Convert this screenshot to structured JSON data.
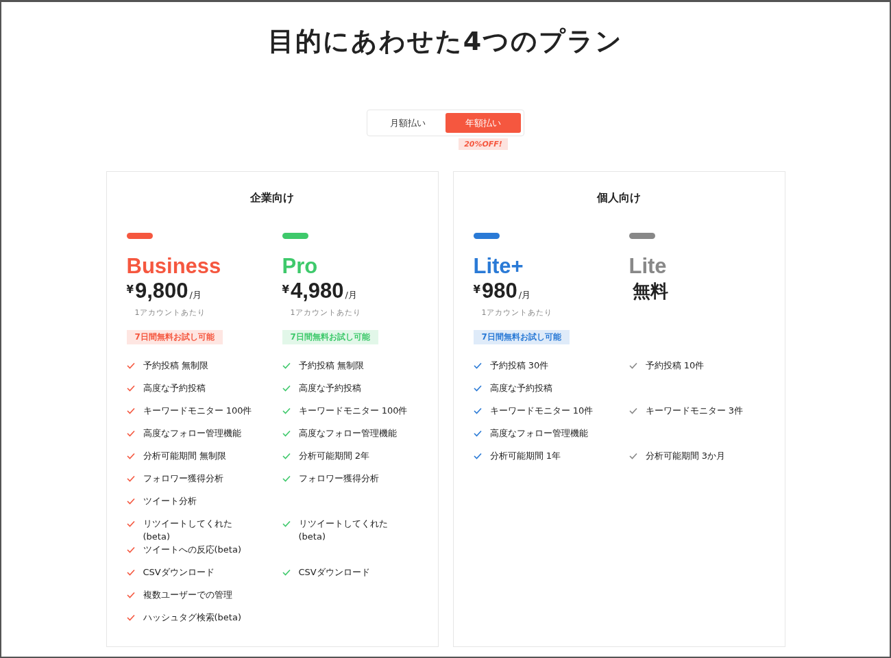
{
  "title": "目的にあわせた4つのプラン",
  "billing_toggle": {
    "options": [
      {
        "label": "月額払い",
        "selected": false
      },
      {
        "label": "年額払い",
        "selected": true
      }
    ],
    "discount_badge": "20%OFF!"
  },
  "groups": [
    {
      "title": "企業向け",
      "plans": [
        {
          "name": "Business",
          "color": "#f5573f",
          "price": {
            "kind": "paid",
            "currency": "¥",
            "amount": "9,800",
            "unit": "/月",
            "note": "1アカウントあたり"
          },
          "trial": "7日間無料お試し可能"
        },
        {
          "name": "Pro",
          "color": "#3ec96b",
          "price": {
            "kind": "paid",
            "currency": "¥",
            "amount": "4,980",
            "unit": "/月",
            "note": "1アカウントあたり"
          },
          "trial": "7日間無料お試し可能"
        }
      ],
      "feature_rows": [
        {
          "cells": [
            "予約投稿 無制限",
            "予約投稿 無制限"
          ]
        },
        {
          "cells": [
            "高度な予約投稿",
            "高度な予約投稿"
          ]
        },
        {
          "cells": [
            "キーワードモニター 100件",
            "キーワードモニター 100件"
          ]
        },
        {
          "cells": [
            "高度なフォロー管理機能",
            "高度なフォロー管理機能"
          ]
        },
        {
          "cells": [
            "分析可能期間 無制限",
            "分析可能期間 2年"
          ]
        },
        {
          "cells": [
            "フォロワー獲得分析",
            "フォロワー獲得分析"
          ]
        },
        {
          "cells": [
            "ツイート分析",
            null
          ]
        },
        {
          "cells": [
            "リツイートしてくれた\n(beta)",
            "リツイートしてくれた\n(beta)"
          ]
        },
        {
          "cells": [
            "ツイートへの反応(beta)",
            null
          ]
        },
        {
          "cells": [
            "CSVダウンロード",
            "CSVダウンロード"
          ]
        },
        {
          "cells": [
            "複数ユーザーでの管理",
            null
          ]
        },
        {
          "cells": [
            "ハッシュタグ検索(beta)",
            null
          ]
        }
      ]
    },
    {
      "title": "個人向け",
      "plans": [
        {
          "name": "Lite+",
          "color": "#2a7ad6",
          "price": {
            "kind": "paid",
            "currency": "¥",
            "amount": "980",
            "unit": "/月",
            "note": "1アカウントあたり"
          },
          "trial": "7日間無料お試し可能"
        },
        {
          "name": "Lite",
          "color": "#888888",
          "price": {
            "kind": "free",
            "amount": "無料"
          }
        }
      ],
      "feature_rows": [
        {
          "cells": [
            "予約投稿 30件",
            "予約投稿 10件"
          ]
        },
        {
          "cells": [
            "高度な予約投稿",
            null
          ]
        },
        {
          "cells": [
            "キーワードモニター 10件",
            "キーワードモニター 3件"
          ]
        },
        {
          "cells": [
            "高度なフォロー管理機能",
            null
          ]
        },
        {
          "cells": [
            "分析可能期間 1年",
            "分析可能期間 3か月"
          ]
        }
      ]
    }
  ]
}
